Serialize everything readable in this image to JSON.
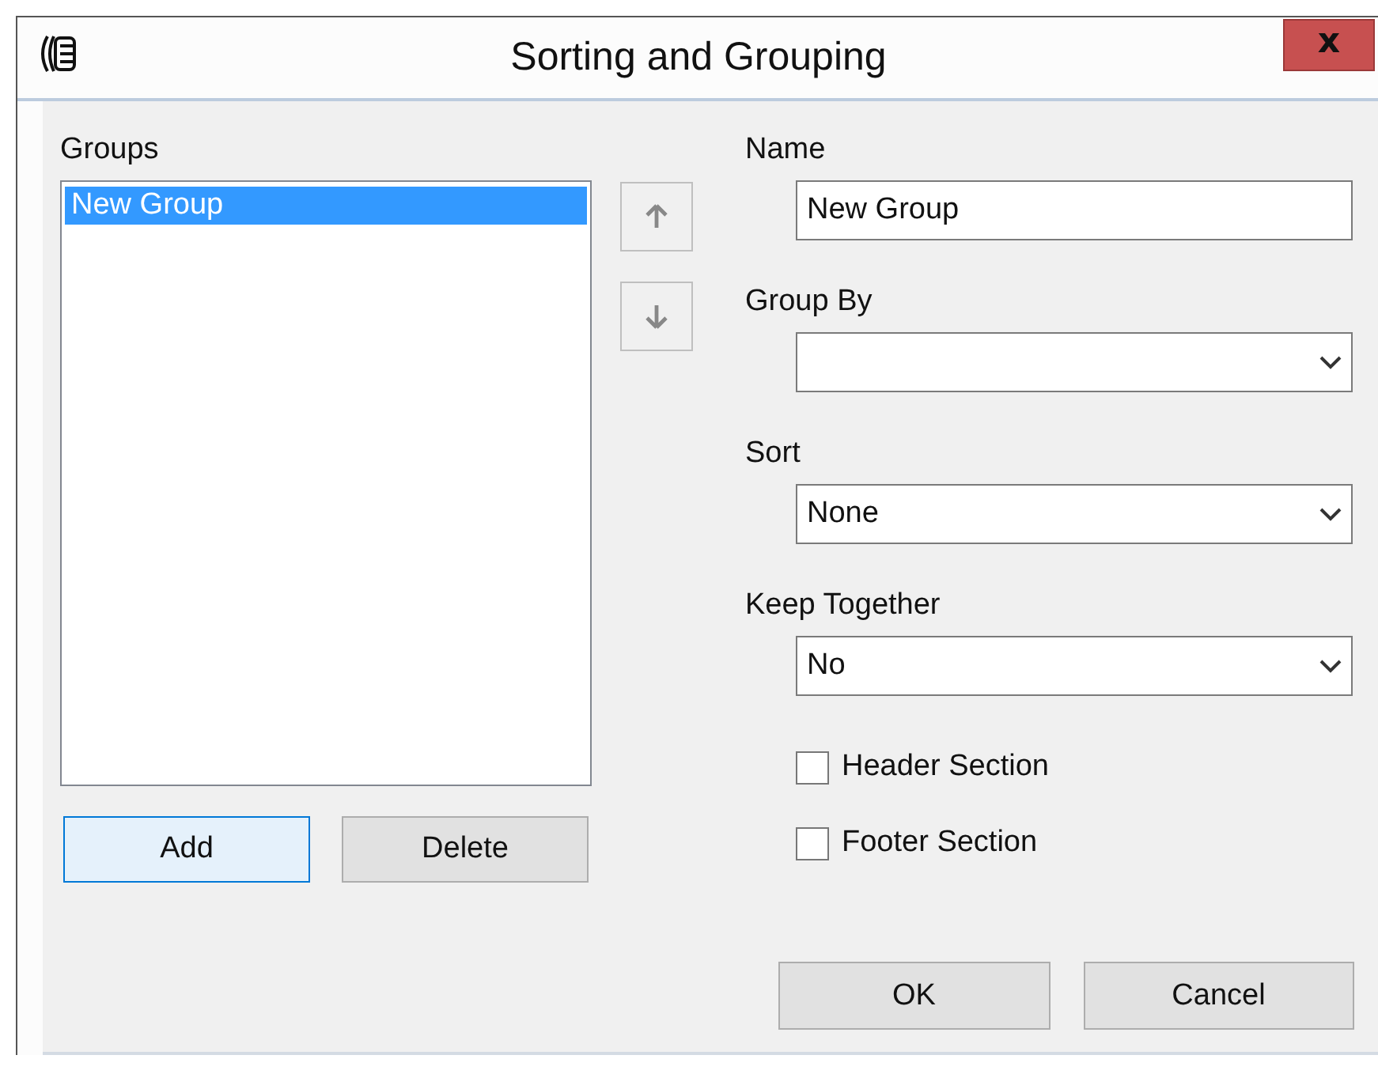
{
  "window": {
    "title": "Sorting and Grouping",
    "close": "x"
  },
  "groups": {
    "label": "Groups",
    "items": [
      {
        "label": "New Group",
        "selected": true
      }
    ],
    "buttons": [
      "Add",
      "Delete"
    ]
  },
  "fields": [
    {
      "kind": "text",
      "label": "Name",
      "value": "New Group"
    },
    {
      "kind": "select",
      "label": "Group By"
    },
    {
      "kind": "select",
      "label": "Sort",
      "value": "None"
    },
    {
      "kind": "select",
      "label": "Keep Together",
      "value": "No"
    }
  ],
  "checkboxes": [
    {
      "label": "Header Section",
      "checked": false
    },
    {
      "label": "Footer Section",
      "checked": false
    }
  ],
  "buttons": [
    "OK",
    "Cancel"
  ]
}
